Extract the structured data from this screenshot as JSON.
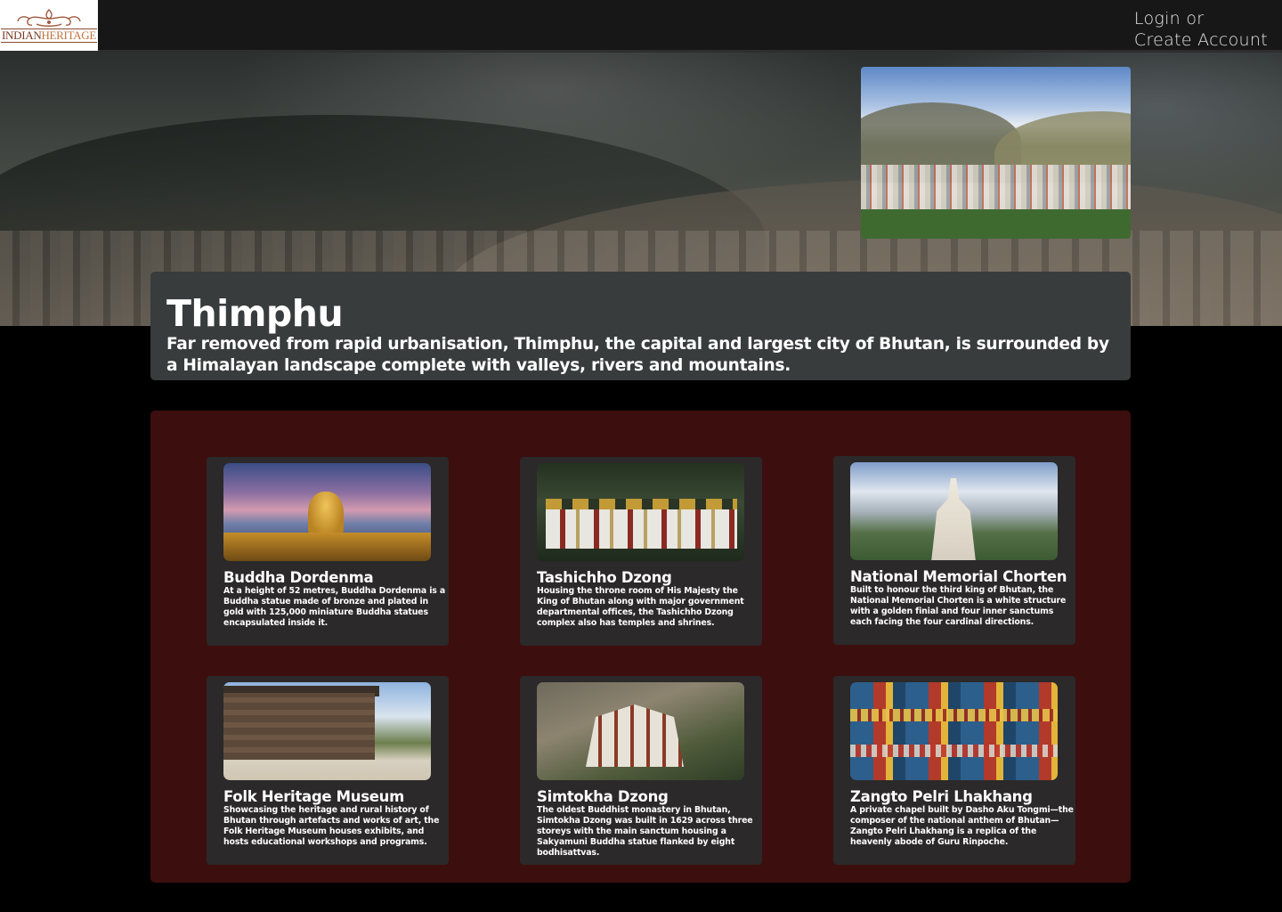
{
  "header": {
    "logo_part1": "INDIAN",
    "logo_part2": "HERITAGE",
    "login_label": "Login or",
    "create_account_label": "Create Account"
  },
  "intro": {
    "title": "Thimphu",
    "description": "Far removed from rapid urbanisation, Thimphu, the capital and largest city of Bhutan, is surrounded by a Himalayan landscape complete with valleys, rivers and mountains."
  },
  "attractions": [
    {
      "title": "Buddha Dordenma",
      "description": "At a height of 52 metres, Buddha Dordenma is a Buddha statue made of bronze and plated in gold with 125,000 miniature Buddha statues encapsulated inside it."
    },
    {
      "title": "Tashichho Dzong",
      "description": "Housing the throne room of His Majesty the King of Bhutan along with major government departmental offices, the Tashichho Dzong complex also has temples and shrines."
    },
    {
      "title": "National Memorial Chorten",
      "description": "Built to honour the third king of Bhutan, the National Memorial Chorten is a white structure with a golden finial and four inner sanctums each facing the four cardinal directions."
    },
    {
      "title": "Folk Heritage Museum",
      "description": "Showcasing the heritage and rural history of Bhutan through artefacts and works of art, the Folk Heritage Museum houses exhibits, and hosts educational workshops and programs."
    },
    {
      "title": "Simtokha Dzong",
      "description": "The oldest Buddhist monastery in Bhutan, Simtokha Dzong was built in 1629 across three storeys with the main sanctum housing a Sakyamuni Buddha statue flanked by eight bodhisattvas."
    },
    {
      "title": "Zangto Pelri Lhakhang",
      "description": "A private chapel built by Dasho Aku Tongmi—the composer of the national anthem of Bhutan—Zangto Pelri Lhakhang is a replica of the heavenly abode of Guru Rinpoche."
    }
  ],
  "colors": {
    "topbar": "#171717",
    "intro_panel": "#393c3c",
    "attractions_panel": "#3d0e0e",
    "card": "#2b2929",
    "logo_brown": "#7a3a24",
    "logo_orange": "#c0743f"
  }
}
